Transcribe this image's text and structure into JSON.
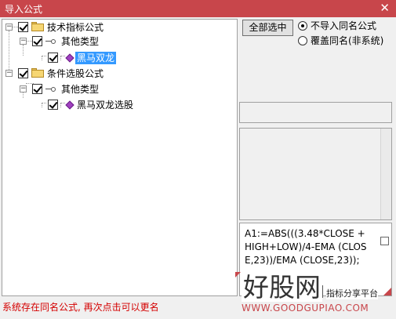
{
  "window": {
    "title": "导入公式",
    "close_glyph": "✕"
  },
  "tree": {
    "nodes": [
      {
        "label": "技术指标公式"
      },
      {
        "label": "其他类型"
      },
      {
        "label": "黑马双龙"
      },
      {
        "label": "条件选股公式"
      },
      {
        "label": "其他类型"
      },
      {
        "label": "黑马双龙选股"
      }
    ],
    "expander_glyph": "−"
  },
  "options": {
    "select_all_label": "全部选中",
    "radio_no_import_label": "不导入同名公式",
    "radio_overwrite_label": "覆盖同名(非系统)",
    "selected": "不导入同名公式"
  },
  "formula_text": "A1:=ABS(((3.48*CLOSE +HIGH+LOW)/4-EMA (CLOSE,23))/EMA (CLOSE,23));",
  "watermark": {
    "main": "好股网",
    "tag": "指标分享平台",
    "url": "WWW.GOODGUPIAO.COM"
  },
  "status_text": "系统存在同名公式, 再次点击可以更名",
  "colors": {
    "title_bg": "#c8464b",
    "selection": "#3399ff",
    "status_text": "#d40000"
  }
}
